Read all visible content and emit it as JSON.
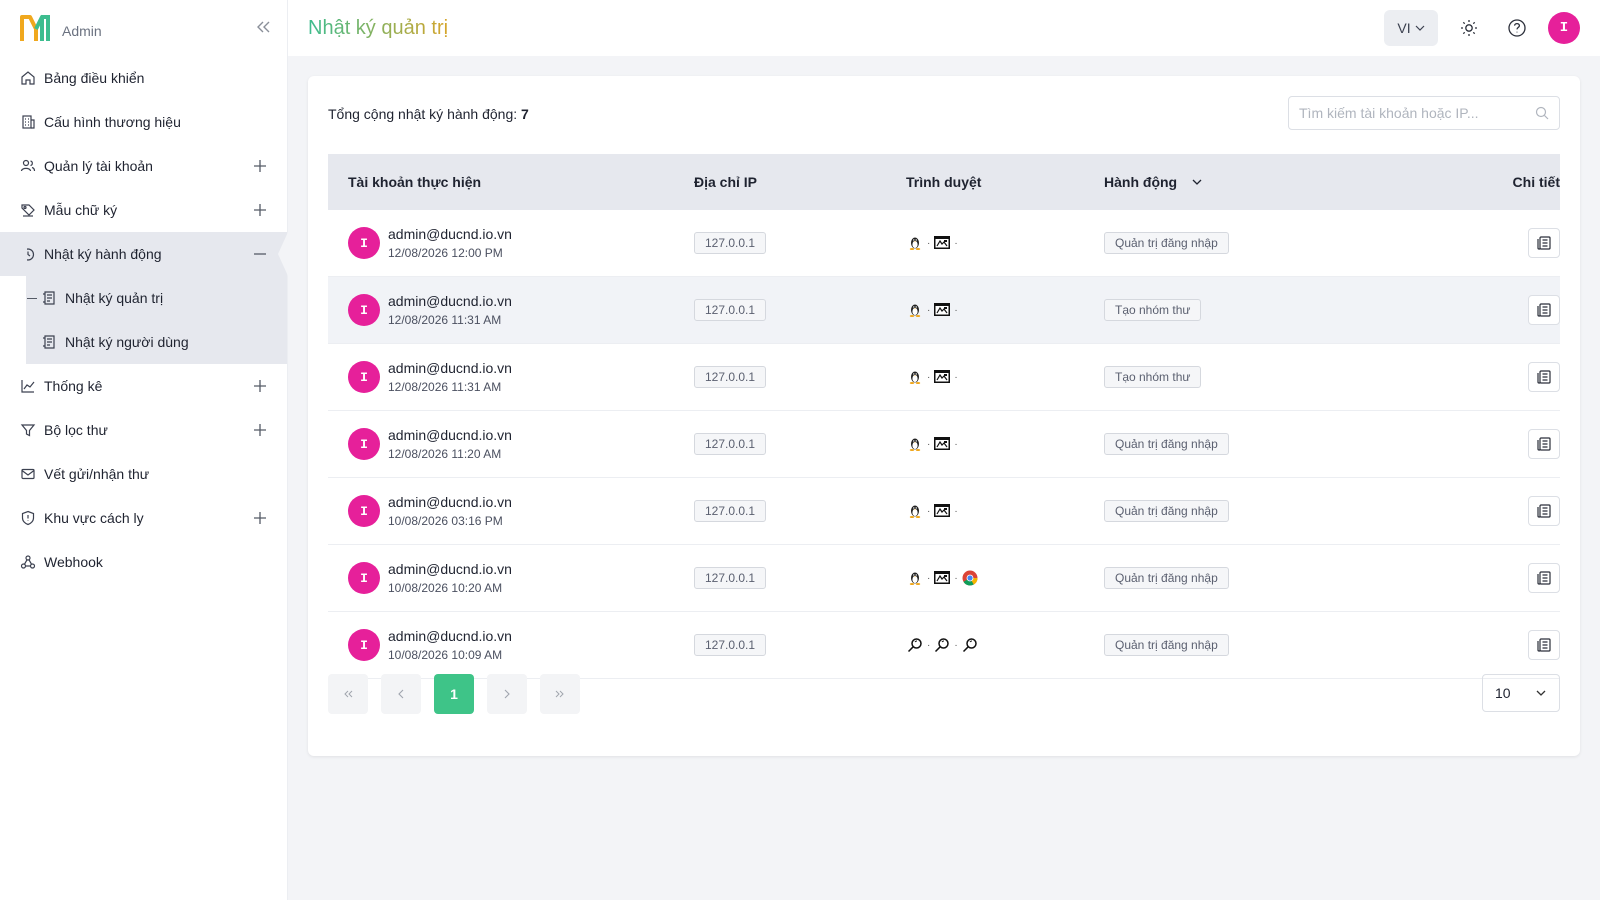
{
  "brand": {
    "admin_label": "Admin",
    "colors": {
      "green": "#3dbd8f",
      "gold": "#d6a52b"
    }
  },
  "sidebar": {
    "items": [
      {
        "label": "Bảng điều khiển",
        "icon": "home-icon"
      },
      {
        "label": "Cấu hình thương hiệu",
        "icon": "building-icon"
      },
      {
        "label": "Quản lý tài khoản",
        "icon": "users-icon",
        "toggle": "plus"
      },
      {
        "label": "Mẫu chữ ký",
        "icon": "signature-icon",
        "toggle": "plus"
      },
      {
        "label": "Nhật ký hành động",
        "icon": "history-icon",
        "toggle": "minus",
        "expanded": true,
        "children": [
          {
            "label": "Nhật ký quản trị",
            "icon": "log-icon",
            "current": true
          },
          {
            "label": "Nhật ký người dùng",
            "icon": "log-icon"
          }
        ]
      },
      {
        "label": "Thống kê",
        "icon": "chart-icon",
        "toggle": "plus"
      },
      {
        "label": "Bộ lọc thư",
        "icon": "filter-icon",
        "toggle": "plus"
      },
      {
        "label": "Vết gửi/nhận thư",
        "icon": "mail-icon"
      },
      {
        "label": "Khu vực cách ly",
        "icon": "shield-icon",
        "toggle": "plus"
      },
      {
        "label": "Webhook",
        "icon": "webhook-icon"
      }
    ]
  },
  "header": {
    "title": "Nhật ký quản trị",
    "language": "VI",
    "user_initial": "I",
    "avatar_color": "#e6209a"
  },
  "main": {
    "total_label": "Tổng cộng nhật ký hành động: ",
    "total_count": "7",
    "search_placeholder": "Tìm kiếm tài khoản hoặc IP...",
    "columns": {
      "account": "Tài khoản thực hiện",
      "ip": "Địa chỉ IP",
      "browser": "Trình duyệt",
      "action": "Hành động",
      "detail": "Chi tiết"
    },
    "rows": [
      {
        "initial": "I",
        "email": "admin@ducnd.io.vn",
        "time": "12/08/2026 12:00 PM",
        "ip": "127.0.0.1",
        "browser": [
          "linux-icon",
          "unknown-browser-icon"
        ],
        "action": "Quản trị đăng nhập"
      },
      {
        "initial": "I",
        "email": "admin@ducnd.io.vn",
        "time": "12/08/2026 11:31 AM",
        "ip": "127.0.0.1",
        "browser": [
          "linux-icon",
          "unknown-browser-icon"
        ],
        "action": "Tạo nhóm thư"
      },
      {
        "initial": "I",
        "email": "admin@ducnd.io.vn",
        "time": "12/08/2026 11:31 AM",
        "ip": "127.0.0.1",
        "browser": [
          "linux-icon",
          "unknown-browser-icon"
        ],
        "action": "Tạo nhóm thư"
      },
      {
        "initial": "I",
        "email": "admin@ducnd.io.vn",
        "time": "12/08/2026 11:20 AM",
        "ip": "127.0.0.1",
        "browser": [
          "linux-icon",
          "unknown-browser-icon"
        ],
        "action": "Quản trị đăng nhập"
      },
      {
        "initial": "I",
        "email": "admin@ducnd.io.vn",
        "time": "10/08/2026 03:16 PM",
        "ip": "127.0.0.1",
        "browser": [
          "linux-icon",
          "unknown-browser-icon"
        ],
        "action": "Quản trị đăng nhập"
      },
      {
        "initial": "I",
        "email": "admin@ducnd.io.vn",
        "time": "10/08/2026 10:20 AM",
        "ip": "127.0.0.1",
        "browser": [
          "linux-icon",
          "unknown-browser-icon",
          "chrome-icon"
        ],
        "action": "Quản trị đăng nhập"
      },
      {
        "initial": "I",
        "email": "admin@ducnd.io.vn",
        "time": "10/08/2026 10:09 AM",
        "ip": "127.0.0.1",
        "browser": [
          "search-icon",
          "search-icon",
          "search-icon"
        ],
        "action": "Quản trị đăng nhập"
      }
    ],
    "pagination": {
      "current_page": "1",
      "page_size": "10"
    },
    "accent_color": "#3ec488"
  }
}
